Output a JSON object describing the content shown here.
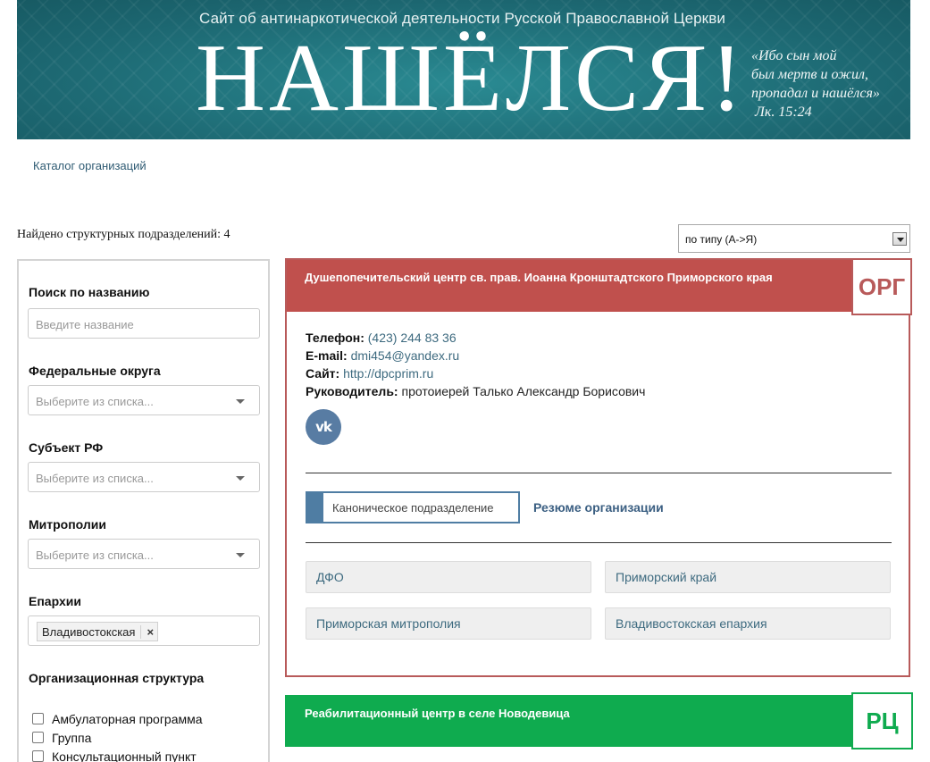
{
  "banner": {
    "subtitle": "Сайт об антинаркотической деятельности Русской Православной Церкви",
    "title": "НАШЁЛСЯ!",
    "quote_lines": [
      "«Ибо сын мой",
      "был мертв и ожил,",
      "пропадал и нашёлся»"
    ],
    "quote_ref": "Лк. 15:24"
  },
  "breadcrumb": "Каталог организаций",
  "found_text": "Найдено структурных подразделений: 4",
  "sort": {
    "selected": "по типу (А->Я)"
  },
  "sidebar": {
    "search_label": "Поиск по названию",
    "search_placeholder": "Введите название",
    "federal_label": "Федеральные округа",
    "subject_label": "Субъект РФ",
    "metropolis_label": "Митрополии",
    "select_placeholder": "Выберите из списка...",
    "eparchy_label": "Епархии",
    "eparchy_tag": "Владивостокская",
    "eparchy_tag_remove": "×",
    "org_structure_label": "Организационная структура",
    "org_types": [
      "Амбулаторная программа",
      "Группа",
      "Консультационный пункт"
    ]
  },
  "cards": [
    {
      "name": "Душепопечительский центр св. прав. Иоанна Кронштадтского Приморского края",
      "badge": "ОРГ",
      "badge_color": "#b85a5a",
      "header_color": "#c0504d",
      "phone_label": "Телефон:",
      "phone": "(423) 244 83 36",
      "email_label": "E-mail:",
      "email": "dmi454@yandex.ru",
      "site_label": "Сайт:",
      "site": "http://dpcprim.ru",
      "head_label": "Руководитель:",
      "head": "протоиерей Талько Александр Борисович",
      "vk_icon_text": "vk",
      "canon_button": "Каноническое подразделение",
      "resume_link": "Резюме организации",
      "tags": [
        "ДФО",
        "Приморский край",
        "Приморская митрополия",
        "Владивостокская епархия"
      ]
    },
    {
      "name": "Реабилитационный центр в селе Новодевица",
      "badge": "РЦ",
      "badge_color": "#0fab4f",
      "header_color": "#0fab4f"
    }
  ]
}
